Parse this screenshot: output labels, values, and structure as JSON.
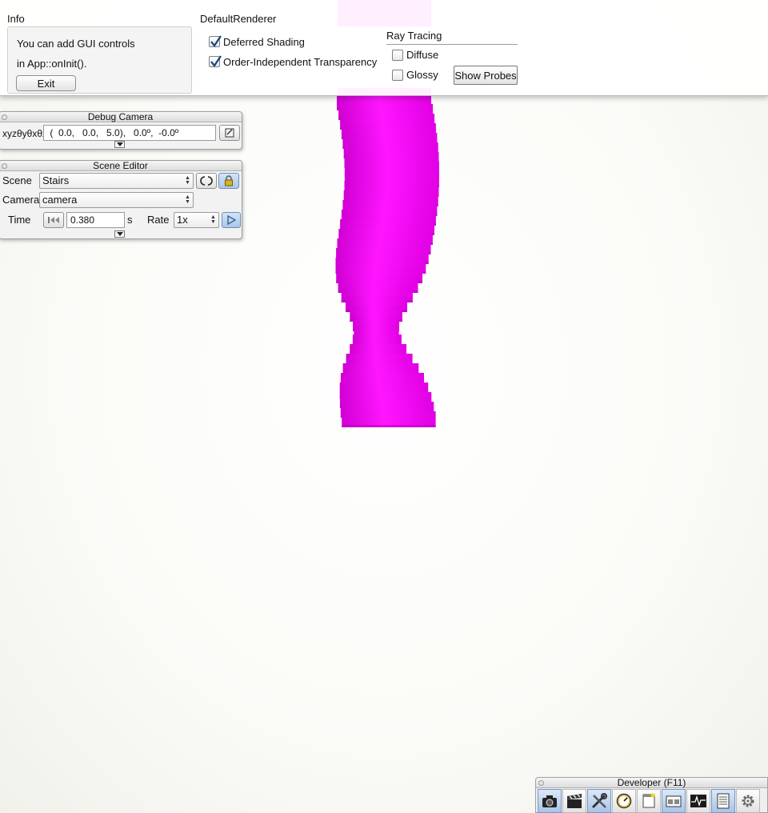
{
  "info": {
    "title": "Info",
    "line1": "You can add GUI controls",
    "line2": "in App::onInit().",
    "exit_label": "Exit"
  },
  "renderer": {
    "title": "DefaultRenderer",
    "deferred_label": "Deferred Shading",
    "deferred_checked": true,
    "oit_label": "Order-Independent Transparency",
    "oit_checked": true,
    "raytracing": {
      "title": "Ray Tracing",
      "diffuse_label": "Diffuse",
      "diffuse_checked": false,
      "glossy_label": "Glossy",
      "glossy_checked": false,
      "show_probes_label": "Show Probes"
    }
  },
  "debug_camera": {
    "title": "Debug Camera",
    "coord_label": "xyzθyθxθz",
    "value": " (  0.0,   0.0,   5.0),   0.0º,  -0.0º"
  },
  "scene_editor": {
    "title": "Scene Editor",
    "scene_label": "Scene",
    "scene_value": "Stairs",
    "camera_label": "Camera",
    "camera_value": "camera",
    "time_label": "Time",
    "time_value": "0.380",
    "time_unit": "s",
    "rate_label": "Rate",
    "rate_value": "1x"
  },
  "developer": {
    "title": "Developer (F11)",
    "tools": [
      "camera-icon",
      "film-clapper-icon",
      "wrench-screwdriver-icon",
      "profiler-dial-icon",
      "window-icon",
      "windows-icon",
      "graph-icon",
      "log-icon",
      "gear-icon"
    ]
  },
  "colors": {
    "stairs": "#ff00ff",
    "accent_active": "#a9c6ea"
  }
}
